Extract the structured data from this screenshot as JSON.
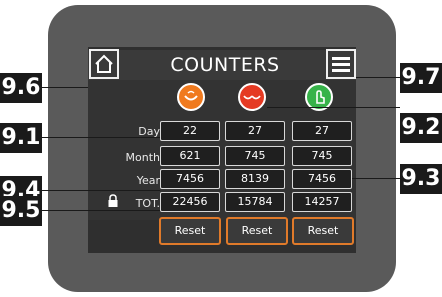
{
  "screen": {
    "title": "COUNTERS",
    "rows": [
      {
        "label": "Day",
        "values": [
          "22",
          "27",
          "27"
        ]
      },
      {
        "label": "Month",
        "values": [
          "621",
          "745",
          "745"
        ]
      },
      {
        "label": "Year",
        "values": [
          "7456",
          "8139",
          "7456"
        ]
      },
      {
        "label": "TOT.",
        "values": [
          "22456",
          "15784",
          "14257"
        ]
      }
    ],
    "reset_label": "Reset",
    "icons": [
      {
        "name": "bowl-icon",
        "color": "#f07a1e"
      },
      {
        "name": "double-bowl-icon",
        "color": "#e53a23"
      },
      {
        "name": "touch-icon",
        "color": "#37b34a"
      }
    ]
  },
  "callouts": {
    "c96": "9.6",
    "c97": "9.7",
    "c91": "9.1",
    "c92": "9.2",
    "c93": "9.3",
    "c94": "9.4",
    "c95": "9.5"
  }
}
